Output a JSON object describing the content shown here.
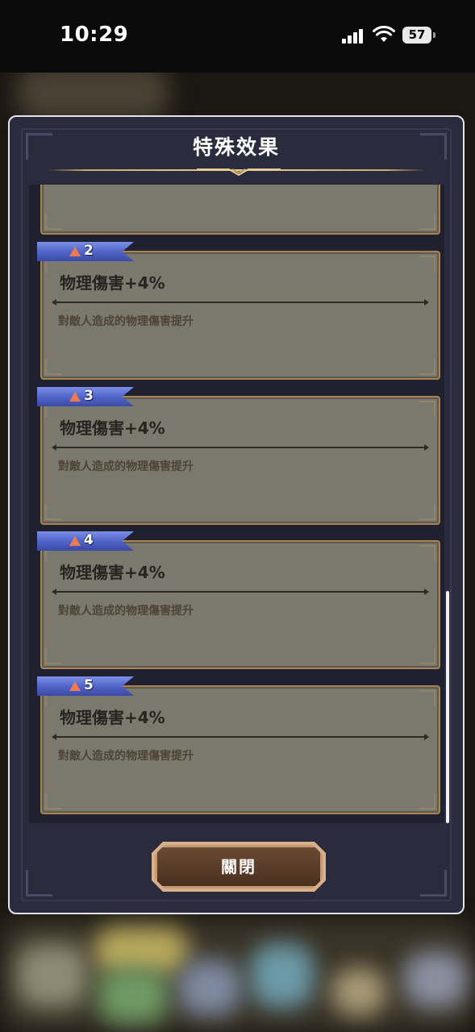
{
  "status_bar": {
    "time": "10:29",
    "battery": "57"
  },
  "dialog": {
    "title": "特殊效果",
    "close_label": "關閉"
  },
  "effects": [
    {
      "level": "2",
      "name": "物理傷害+4%",
      "description": "對敵人造成的物理傷害提升"
    },
    {
      "level": "3",
      "name": "物理傷害+4%",
      "description": "對敵人造成的物理傷害提升"
    },
    {
      "level": "4",
      "name": "物理傷害+4%",
      "description": "對敵人造成的物理傷害提升"
    },
    {
      "level": "5",
      "name": "物理傷害+4%",
      "description": "對敵人造成的物理傷害提升"
    }
  ],
  "colors": {
    "dialog_bg": "#2a2b3c",
    "card_bg": "#7b786d",
    "tag_blue": "#4f63c6",
    "close_button": "#5a3d28"
  },
  "icons": [
    "signal-icon",
    "wifi-icon",
    "battery-icon",
    "up-triangle-icon"
  ]
}
